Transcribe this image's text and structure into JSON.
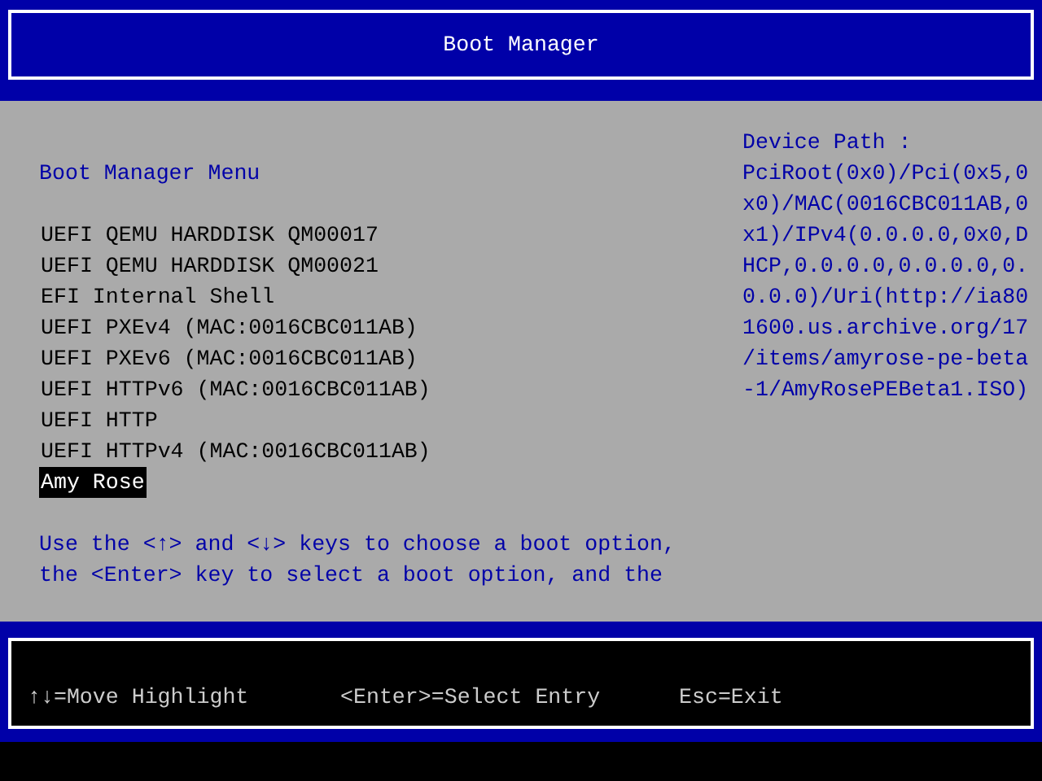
{
  "window": {
    "title": "Boot Manager"
  },
  "menu_title": "Boot Manager Menu",
  "boot_options": [
    {
      "label": "UEFI QEMU HARDDISK QM00017",
      "selected": false
    },
    {
      "label": "UEFI QEMU HARDDISK QM00021",
      "selected": false
    },
    {
      "label": "EFI Internal Shell",
      "selected": false
    },
    {
      "label": "UEFI PXEv4 (MAC:0016CBC011AB)",
      "selected": false
    },
    {
      "label": "UEFI PXEv6 (MAC:0016CBC011AB)",
      "selected": false
    },
    {
      "label": "UEFI HTTPv6 (MAC:0016CBC011AB)",
      "selected": false
    },
    {
      "label": "UEFI HTTP",
      "selected": false
    },
    {
      "label": "UEFI HTTPv4 (MAC:0016CBC011AB)",
      "selected": false
    },
    {
      "label": "Amy Rose",
      "selected": true
    }
  ],
  "help_text": [
    "Use the <↑> and <↓> keys to choose a boot option,",
    "the <Enter> key to select a boot option, and the"
  ],
  "device_path": {
    "heading": "Device Path :",
    "lines": [
      "PciRoot(0x0)/Pci(0x5,0",
      "x0)/MAC(0016CBC011AB,0",
      "x1)/IPv4(0.0.0.0,0x0,D",
      "HCP,0.0.0.0,0.0.0.0,0.",
      "0.0.0)/Uri(http://ia80",
      "1600.us.archive.org/17",
      "/items/amyrose-pe-beta",
      "-1/AmyRosePEBeta1.ISO)"
    ]
  },
  "status_bar": [
    "↑↓=Move Highlight",
    "<Enter>=Select Entry",
    "Esc=Exit"
  ]
}
